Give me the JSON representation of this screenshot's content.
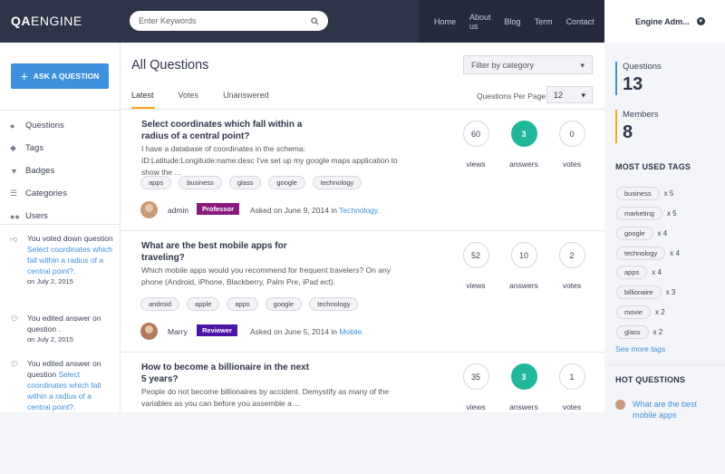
{
  "header": {
    "logo_bold": "QA",
    "logo_rest": "ENGINE",
    "search_placeholder": "Enter Keywords",
    "nav": [
      "Home",
      "About us",
      "Blog",
      "Term",
      "Contact"
    ],
    "user_name": "Engine Adm..."
  },
  "left": {
    "ask_button": "ASK A QUESTION",
    "menu": [
      {
        "label": "Questions",
        "icon": "question-circle-icon"
      },
      {
        "label": "Tags",
        "icon": "tags-icon"
      },
      {
        "label": "Badges",
        "icon": "trophy-icon"
      },
      {
        "label": "Categories",
        "icon": "list-icon"
      },
      {
        "label": "Users",
        "icon": "users-icon"
      }
    ],
    "activity": [
      {
        "icon": "thumbs-down-icon",
        "text": "You voted down question",
        "link": "Select coordinates which fall within a radius of a central point?.",
        "date": "on July 2, 2015"
      },
      {
        "icon": "comment-icon",
        "text": "You edited answer on question .",
        "link": "",
        "date": "on July 2, 2015"
      },
      {
        "icon": "comment-icon",
        "text": "You edited answer on question",
        "link": "Select coordinates which fall within a radius of a central point?.",
        "date": ""
      }
    ]
  },
  "main": {
    "title": "All Questions",
    "filter_placeholder": "Filter by category",
    "tabs": [
      "Latest",
      "Votes",
      "Unanswered"
    ],
    "per_page_label": "Questions Per Page:",
    "per_page_value": "12",
    "stat_labels": [
      "views",
      "answers",
      "votes"
    ],
    "questions": [
      {
        "title": "Select coordinates which fall within a radius of a central point?",
        "excerpt": "I have a database of coordinates in the schema: ID:Latitude:Longitude:name:desc I've set up my google maps application to show the ...",
        "tags": [
          "apps",
          "business",
          "glass",
          "google",
          "technology"
        ],
        "author": "admin",
        "role": "Professor",
        "role_color": "#8a1a7e",
        "asked": "Asked on June 9, 2014 in",
        "category": "Technology.",
        "views": "60",
        "answers": "3",
        "votes": "0",
        "answered": true
      },
      {
        "title": "What are the best mobile apps for traveling?",
        "excerpt": "Which mobile apps would you recommend for frequent travelers? On any phone (Android, iPhone, Blackberry, Palm Pre, iPad ect).",
        "tags": [
          "android",
          "apple",
          "apps",
          "google",
          "technology"
        ],
        "author": "Marry",
        "role": "Reviewer",
        "role_color": "#4b16a8",
        "asked": "Asked on June 5, 2014 in",
        "category": "Mobile.",
        "views": "52",
        "answers": "10",
        "votes": "2",
        "answered": false
      },
      {
        "title": "How to become a billionaire in the next 5 years?",
        "excerpt": "People do not become billionaires by accident. Demystify as many of the variables as you can before you assemble a ...",
        "tags": [],
        "author": "",
        "role": "",
        "role_color": "",
        "asked": "",
        "category": "",
        "views": "35",
        "answers": "3",
        "votes": "1",
        "answered": true
      }
    ]
  },
  "sidebar": {
    "questions_label": "Questions",
    "questions_count": "13",
    "questions_color": "#3d91de",
    "members_label": "Members",
    "members_count": "8",
    "members_color": "#f5a623",
    "most_used_title": "MOST USED TAGS",
    "tags": [
      {
        "name": "business",
        "count": "x 5"
      },
      {
        "name": "marketing",
        "count": "x 5"
      },
      {
        "name": "google",
        "count": "x 4"
      },
      {
        "name": "technology",
        "count": "x 4"
      },
      {
        "name": "apps",
        "count": "x 4"
      },
      {
        "name": "billionaire",
        "count": "x 3"
      },
      {
        "name": "movie",
        "count": "x 2"
      },
      {
        "name": "glass",
        "count": "x 2"
      }
    ],
    "see_more": "See more tags",
    "hot_title": "HOT QUESTIONS",
    "hot_first": "What are the best mobile apps"
  }
}
